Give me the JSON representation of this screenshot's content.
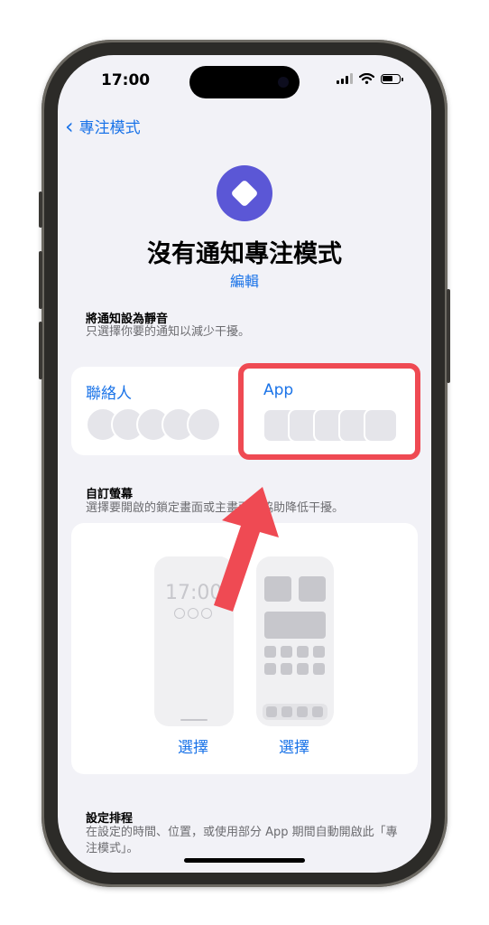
{
  "status_bar": {
    "time": "17:00"
  },
  "nav": {
    "back_label": "專注模式"
  },
  "header": {
    "icon": "diamond-focus-icon",
    "title": "沒有通知專注模式",
    "edit_label": "編輯"
  },
  "silence": {
    "heading": "將通知設為靜音",
    "subtitle": "只選擇你要的通知以減少干擾。",
    "people_label": "聯絡人",
    "apps_label": "App"
  },
  "screens": {
    "heading": "自訂螢幕",
    "subtitle": "選擇要開啟的鎖定畫面或主畫面來協助降低干擾。",
    "lock_time": "17:00",
    "lock_choose": "選擇",
    "home_choose": "選擇"
  },
  "schedule": {
    "heading": "設定排程",
    "subtitle": "在設定的時間、位置，或使用部分 App 期間自動開啟此「專注模式」。"
  },
  "colors": {
    "accent": "#1a73e8",
    "focus_icon": "#5b57d6",
    "highlight": "#ef4a53"
  }
}
